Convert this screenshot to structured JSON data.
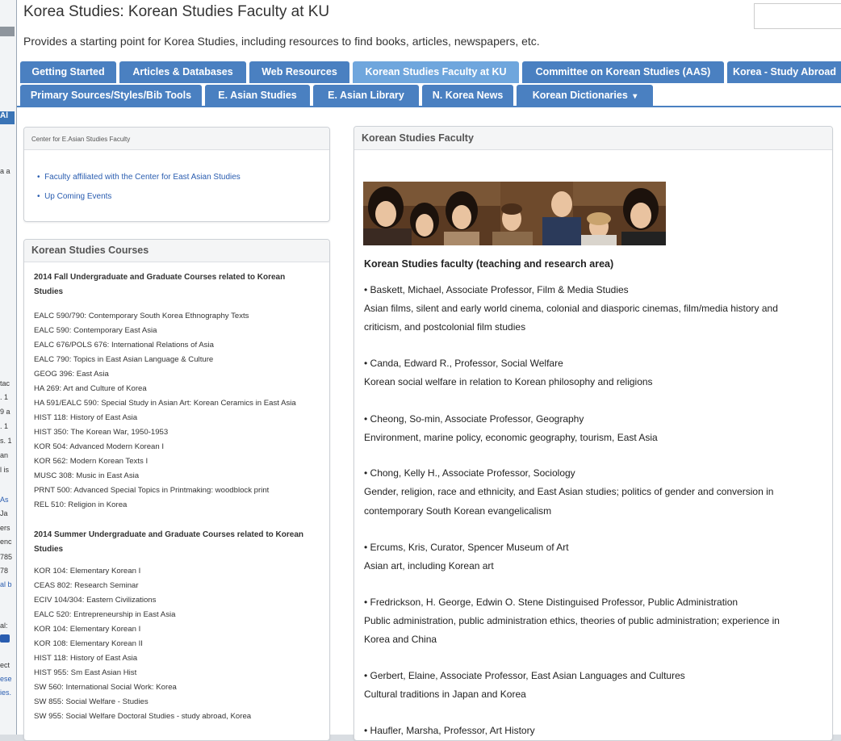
{
  "page": {
    "title": "Korea Studies: Korean Studies Faculty at KU",
    "description": "Provides a starting point for Korea Studies, including resources to find books, articles, newspapers, etc.",
    "search_value": ""
  },
  "tabs_row1": [
    {
      "label": "Getting Started"
    },
    {
      "label": "Articles & Databases"
    },
    {
      "label": "Web Resources"
    },
    {
      "label": "Korean Studies Faculty at KU"
    },
    {
      "label": "Committee on Korean Studies (AAS)"
    },
    {
      "label": "Korea - Study Abroad"
    }
  ],
  "tabs_row2": [
    {
      "label": "Primary Sources/Styles/Bib Tools"
    },
    {
      "label": "E. Asian Studies"
    },
    {
      "label": "E. Asian Library"
    },
    {
      "label": "N. Korea News"
    },
    {
      "label": "Korean Dictionaries",
      "caret": "▾"
    }
  ],
  "center_box": {
    "heading": "Center for E.Asian Studies Faculty",
    "links": [
      "Faculty affiliated with the Center for East Asian Studies",
      "Up Coming Events"
    ]
  },
  "courses_box": {
    "heading": "Korean Studies Courses",
    "fall_heading": "2014 Fall Undergraduate and Graduate Courses related to Korean Studies",
    "fall_courses": [
      "EALC 590/790: Contemporary South Korea Ethnography Texts",
      "EALC 590: Contemporary East Asia",
      "EALC 676/POLS 676: International Relations of Asia",
      "EALC 790: Topics in East Asian Language & Culture",
      "GEOG 396: East Asia",
      "HA 269: Art and Culture of Korea",
      "HA 591/EALC 590: Special Study in Asian Art: Korean Ceramics in East Asia",
      "HIST 118: History of East Asia",
      "HIST 350: The Korean War, 1950-1953",
      "KOR 504: Advanced Modern Korean I",
      "KOR 562: Modern Korean Texts I",
      "MUSC 308: Music in East Asia",
      "PRNT 500: Advanced Special Topics in Printmaking: woodblock print",
      "REL 510: Religion in Korea"
    ],
    "summer_heading": "2014 Summer Undergraduate and Graduate Courses related to Korean Studies",
    "summer_courses": [
      "KOR 104: Elementary Korean I",
      "CEAS 802: Research Seminar",
      "ECIV 104/304: Eastern Civilizations",
      "EALC 520: Entrepreneurship in East Asia",
      "KOR 104: Elementary Korean I",
      "KOR 108: Elementary Korean II",
      "HIST 118: History of East Asia",
      "HIST 955: Sm East Asian Hist",
      "SW 560: International Social Work: Korea",
      "SW 855: Social Welfare - Studies",
      "SW 955: Social Welfare Doctoral Studies - study abroad, Korea"
    ]
  },
  "faculty_box": {
    "heading": "Korean Studies Faculty",
    "subtitle": "Korean Studies faculty (teaching and research area)",
    "members": [
      {
        "name": "• Baskett, Michael, Associate Professor, Film & Media Studies",
        "area": [
          "Asian films, silent and early world cinema, colonial and diasporic cinemas, film/media history and",
          "criticism, and postcolonial film studies"
        ]
      },
      {
        "name": "• Canda, Edward R., Professor, Social Welfare",
        "area": [
          "Korean social welfare in relation to Korean philosophy and religions"
        ]
      },
      {
        "name": "• Cheong, So-min, Associate Professor, Geography",
        "area": [
          "Environment, marine policy, economic geography, tourism, East Asia"
        ]
      },
      {
        "name": "• Chong, Kelly H., Associate Professor, Sociology",
        "area": [
          "Gender, religion, race and ethnicity, and East Asian studies; politics of gender and conversion in",
          "contemporary South Korean evangelicalism"
        ]
      },
      {
        "name": "• Ercums, Kris, Curator, Spencer Museum of Art",
        "area": [
          "Asian art, including Korean art"
        ]
      },
      {
        "name": "• Fredrickson, H. George, Edwin O. Stene Distinguised Professor, Public Administration",
        "area": [
          "Public administration, public administration ethics, theories of public administration; experience in",
          "Korea and China"
        ]
      },
      {
        "name": "• Gerbert, Elaine, Associate Professor, East Asian Languages and Cultures",
        "area": [
          "Cultural traditions in Japan and Korea"
        ]
      },
      {
        "name": "• Haufler, Marsha, Professor, Art History",
        "area": []
      }
    ]
  },
  "background_window": {
    "fragments": [
      "Al",
      "a a",
      "tac",
      ". 1",
      "9 a",
      ". 1",
      "s. 1",
      "an",
      "l is",
      "As",
      "Ja",
      "ers",
      "enc",
      "785",
      "78",
      "al b",
      "al:",
      "ect",
      "ese",
      "ies."
    ]
  },
  "colors": {
    "tab": "#4a80c1",
    "tab_active": "#6fa6dd",
    "link": "#2a5db0"
  }
}
